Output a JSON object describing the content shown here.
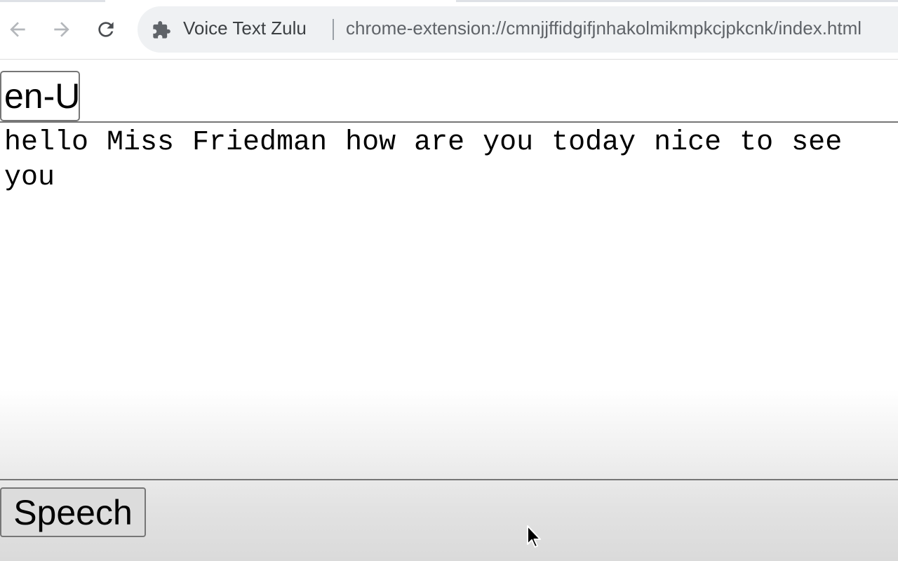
{
  "browser": {
    "extension_name": "Voice Text Zulu",
    "url": "chrome-extension://cmnjjffidgifjnhakolmikmpkcjpkcnk/index.html",
    "icons": [
      "back-arrow-icon",
      "forward-arrow-icon",
      "reload-icon",
      "puzzle-piece-icon"
    ]
  },
  "page": {
    "language_value": "en-US",
    "text_content": "hello Miss Friedman how are you today nice to see you",
    "speech_button_label": "Speech"
  },
  "colors": {
    "icon": "#5f6368",
    "omnibox_bg": "#eff1f3",
    "border": "#767676",
    "button_bg": "#dcdcdc"
  }
}
